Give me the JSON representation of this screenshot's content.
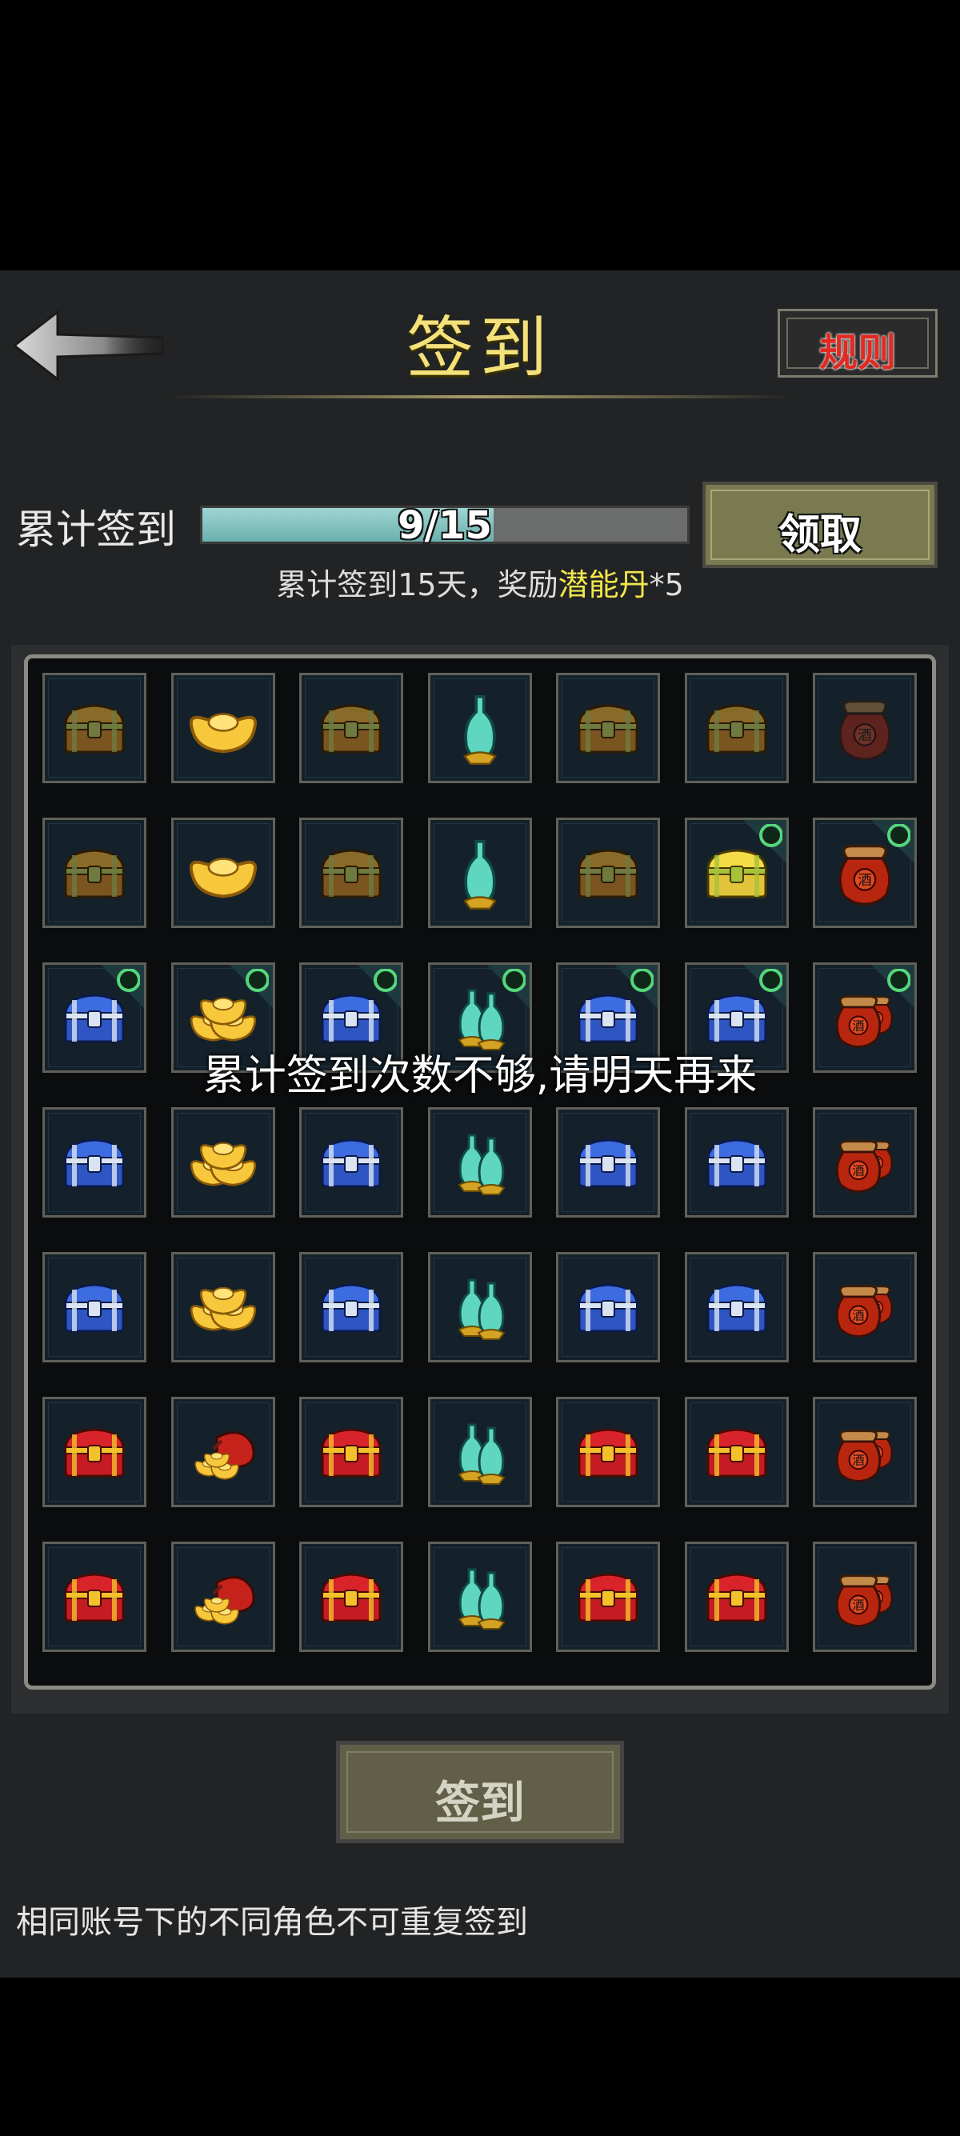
{
  "header": {
    "title": "签到",
    "rules_label": "规则"
  },
  "progress": {
    "label": "累计签到",
    "current": 9,
    "total": 15,
    "text": "9/15",
    "claim_label": "领取"
  },
  "reward": {
    "prefix": "累计签到15天，奖励",
    "item": "潜能丹",
    "suffix": "*5"
  },
  "toast": "累计签到次数不够,请明天再来",
  "sign_button": "签到",
  "notice": "相同账号下的不同角色不可重复签到",
  "colors": {
    "accent": "#f4e17a",
    "rules_red": "#e02a22",
    "progress_fill": "#8cc8c6",
    "check": "#56d67c"
  },
  "grid": [
    [
      "wood-chest-icon",
      "gold-ingot-icon",
      "wood-chest-icon",
      "green-bottle-icon",
      "wood-chest-icon",
      "wood-chest-icon",
      "wine-jar-icon"
    ],
    [
      "wood-chest-icon",
      "gold-ingot-icon",
      "wood-chest-icon",
      "green-bottle-icon",
      "wood-chest-icon",
      "gold-chest-icon",
      "wine-jar-icon"
    ],
    [
      "blue-chest-icon",
      "gold-ingots-icon",
      "blue-chest-icon",
      "green-bottles-icon",
      "blue-chest-icon",
      "blue-chest-icon",
      "wine-jars-icon"
    ],
    [
      "blue-chest-icon",
      "gold-ingots-icon",
      "blue-chest-icon",
      "green-bottles-icon",
      "blue-chest-icon",
      "blue-chest-icon",
      "wine-jars-icon"
    ],
    [
      "blue-chest-icon",
      "gold-ingots-icon",
      "blue-chest-icon",
      "green-bottles-icon",
      "blue-chest-icon",
      "blue-chest-icon",
      "wine-jars-icon"
    ],
    [
      "red-chest-icon",
      "money-bag-icon",
      "red-chest-icon",
      "green-bottles-icon",
      "red-chest-icon",
      "red-chest-icon",
      "wine-jars-icon"
    ],
    [
      "red-chest-icon",
      "money-bag-icon",
      "red-chest-icon",
      "green-bottles-icon",
      "red-chest-icon",
      "red-chest-icon",
      "wine-jars-icon"
    ]
  ],
  "claimable": [
    [
      1,
      5
    ],
    [
      1,
      6
    ],
    [
      2,
      0
    ],
    [
      2,
      1
    ],
    [
      2,
      2
    ],
    [
      2,
      3
    ],
    [
      2,
      4
    ],
    [
      2,
      5
    ],
    [
      2,
      6
    ]
  ],
  "faded_cells": [
    [
      0,
      6
    ]
  ]
}
